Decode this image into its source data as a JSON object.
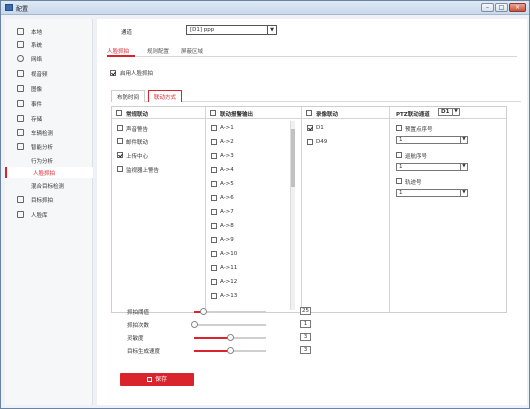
{
  "window": {
    "title": "配置"
  },
  "sidebar": {
    "items": [
      {
        "label": "本地",
        "icon": "monitor-icon"
      },
      {
        "label": "系统",
        "icon": "system-icon"
      },
      {
        "label": "网络",
        "icon": "globe-icon"
      },
      {
        "label": "视音频",
        "icon": "video-icon"
      },
      {
        "label": "图像",
        "icon": "image-icon"
      },
      {
        "label": "事件",
        "icon": "event-icon"
      },
      {
        "label": "存储",
        "icon": "storage-icon"
      },
      {
        "label": "车辆检测",
        "icon": "car-icon"
      },
      {
        "label": "智能分析",
        "icon": "analysis-icon"
      }
    ],
    "subitems": [
      {
        "label": "行为分析"
      },
      {
        "label": "人脸抓拍",
        "active": true
      },
      {
        "label": "混合目标检测"
      }
    ],
    "items2": [
      {
        "label": "目标抓拍",
        "icon": "target-icon"
      },
      {
        "label": "人脸库",
        "icon": "face-library-icon"
      }
    ]
  },
  "channel": {
    "label": "通道",
    "value": "[D1] ppp"
  },
  "tabs": [
    {
      "label": "人脸抓拍",
      "active": true
    },
    {
      "label": "规则配置"
    },
    {
      "label": "屏蔽区域"
    }
  ],
  "enable_label": "启用人脸抓拍",
  "subtabs": [
    {
      "label": "布防时间"
    },
    {
      "label": "联动方式",
      "active": true
    }
  ],
  "columns": {
    "normal": {
      "header": "常规联动",
      "items": [
        {
          "label": "声音警告",
          "checked": false
        },
        {
          "label": "邮件联动",
          "checked": false
        },
        {
          "label": "上传中心",
          "checked": true
        },
        {
          "label": "监视器上警告",
          "checked": false
        }
      ]
    },
    "alarm_out": {
      "header": "联动报警输出",
      "items": [
        "A->1",
        "A->2",
        "A->3",
        "A->4",
        "A->5",
        "A->6",
        "A->7",
        "A->8",
        "A->9",
        "A->10",
        "A->11",
        "A->12",
        "A->13"
      ]
    },
    "record": {
      "header": "录像联动",
      "items": [
        {
          "label": "D1",
          "checked": true
        },
        {
          "label": "D49",
          "checked": false
        }
      ]
    },
    "ptz": {
      "header": "PTZ联动通道",
      "channel": "D1",
      "sections": [
        {
          "label": "预置点序号",
          "value": "1"
        },
        {
          "label": "巡航序号",
          "value": "1"
        },
        {
          "label": "轨迹号",
          "value": "1"
        }
      ]
    }
  },
  "sliders": [
    {
      "label": "抓拍阈值",
      "value": "25",
      "fraction": 0.12
    },
    {
      "label": "抓拍次数",
      "value": "1",
      "fraction": 0.0
    },
    {
      "label": "灵敏度",
      "value": "3",
      "fraction": 0.5
    },
    {
      "label": "目标生成速度",
      "value": "3",
      "fraction": 0.5
    }
  ],
  "save_label": "保存",
  "colors": {
    "accent": "#d9232d"
  }
}
